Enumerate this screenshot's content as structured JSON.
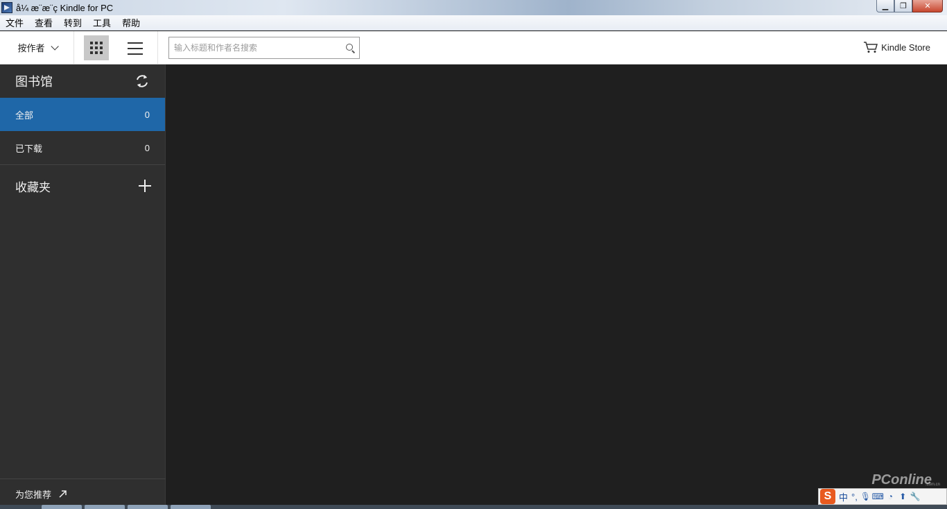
{
  "window": {
    "title": "å¼ æ¨æ¨ç Kindle for PC",
    "controls": {
      "minimize": "▁",
      "maximize": "❐",
      "close": "✕"
    }
  },
  "menu": [
    "文件",
    "查看",
    "转到",
    "工具",
    "帮助"
  ],
  "toolbar": {
    "sort_label": "按作者",
    "view_grid": "grid-view",
    "view_list": "list-view",
    "search_placeholder": "输入标题和作者名搜索",
    "search_value": "",
    "store_label": "Kindle Store"
  },
  "sidebar": {
    "library_title": "图书馆",
    "items": [
      {
        "label": "全部",
        "count": "0",
        "active": true
      },
      {
        "label": "已下载",
        "count": "0",
        "active": false
      }
    ],
    "favorites_title": "收藏夹",
    "recommend_label": "为您推荐"
  },
  "watermark": {
    "text": "PConline",
    "sub": ".com.cn"
  },
  "ime": {
    "logo": "S",
    "mode": "中",
    "punct": "°,"
  },
  "colors": {
    "sidebar_bg": "#2f2f2f",
    "main_bg": "#1f1f1f",
    "active_item": "#1f67a8",
    "toolbar_bg": "#ffffff"
  }
}
